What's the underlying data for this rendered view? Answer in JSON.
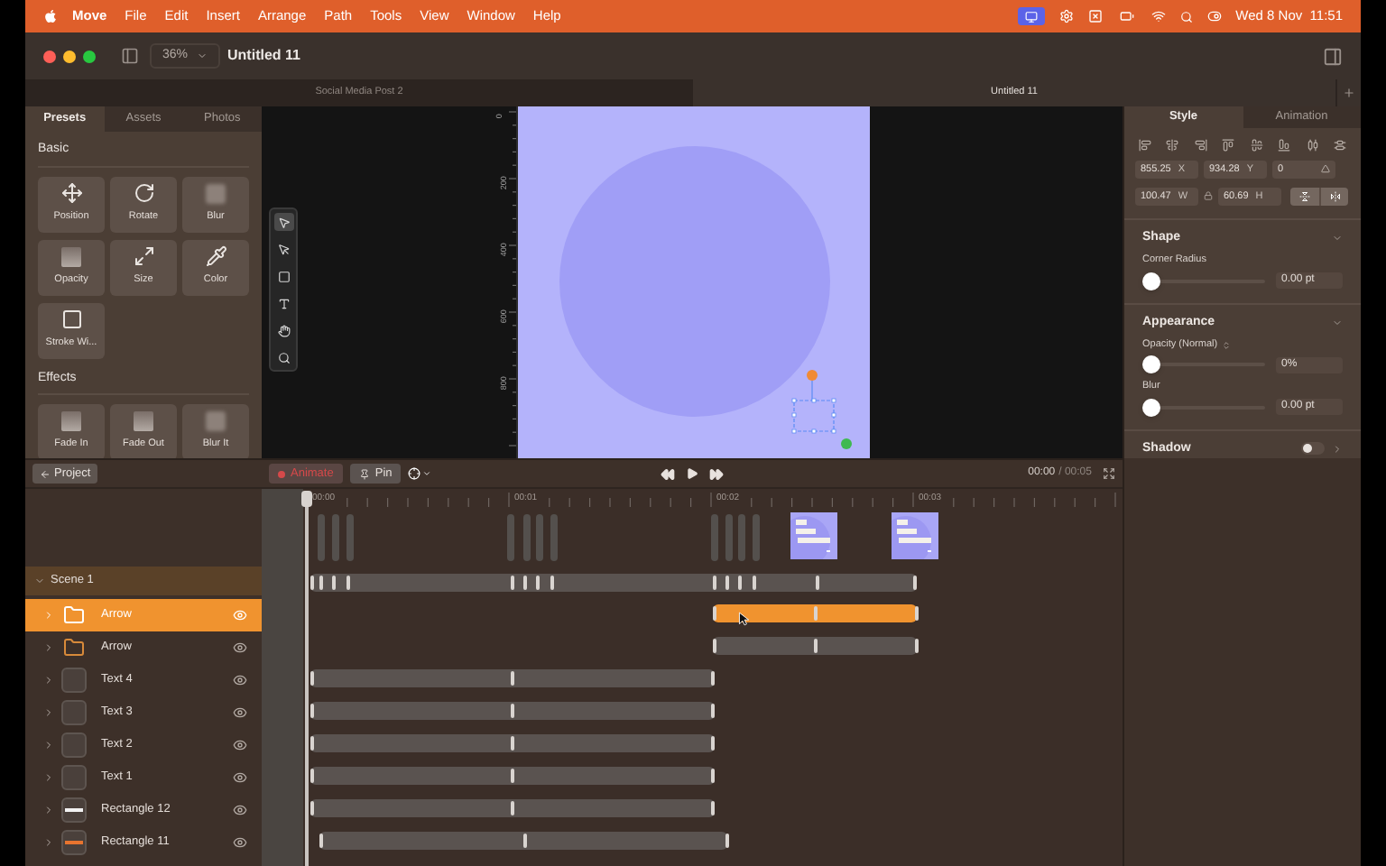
{
  "menu_bar": {
    "app": "Move",
    "items": [
      "File",
      "Edit",
      "Insert",
      "Arrange",
      "Path",
      "Tools",
      "View",
      "Window",
      "Help"
    ],
    "clock": "Wed 8 Nov  11:51"
  },
  "window": {
    "zoom": "36%",
    "title": "Untitled 11"
  },
  "document_tabs": [
    {
      "label": "Social Media Post 2",
      "selected": false
    },
    {
      "label": "Untitled 11",
      "selected": true
    }
  ],
  "library": {
    "tabs": [
      {
        "label": "Presets",
        "selected": true
      },
      {
        "label": "Assets",
        "selected": false
      },
      {
        "label": "Photos",
        "selected": false
      }
    ],
    "sections": [
      {
        "title": "Basic",
        "presets": [
          {
            "label": "Position",
            "kind": "move"
          },
          {
            "label": "Rotate",
            "kind": "rotate"
          },
          {
            "label": "Blur",
            "kind": "blur"
          },
          {
            "label": "Opacity",
            "kind": "fade"
          },
          {
            "label": "Size",
            "kind": "resize"
          },
          {
            "label": "Color",
            "kind": "picker"
          },
          {
            "label": "Stroke Wi...",
            "kind": "stroke"
          }
        ]
      },
      {
        "title": "Effects",
        "presets": [
          {
            "label": "Fade In",
            "kind": "fade"
          },
          {
            "label": "Fade Out",
            "kind": "fade"
          },
          {
            "label": "Blur It",
            "kind": "blur"
          }
        ]
      }
    ]
  },
  "canvas": {
    "ruler_labels": [
      "0",
      "200",
      "400",
      "600",
      "800"
    ],
    "tools": [
      {
        "kind": "select",
        "selected": true
      },
      {
        "kind": "direct",
        "selected": false
      },
      {
        "kind": "shape",
        "selected": false
      },
      {
        "kind": "text",
        "selected": false
      },
      {
        "kind": "hand",
        "selected": false
      },
      {
        "kind": "zoom",
        "selected": false
      }
    ]
  },
  "timeline": {
    "back_button": "Project",
    "animate_button": "Animate",
    "pin_button": "Pin",
    "current_time": "00:00",
    "duration": "/ 00:05",
    "ruler_labels": [
      "00:00",
      "00:01",
      "00:02",
      "00:03"
    ]
  },
  "layers": {
    "scene": {
      "name": "Scene 1",
      "expanded": true
    },
    "items": [
      {
        "name": "Arrow",
        "kind": "group",
        "selected": true,
        "expanded": false
      },
      {
        "name": "Arrow",
        "kind": "group",
        "selected": false,
        "expanded": false
      },
      {
        "name": "Text 4",
        "kind": "text",
        "selected": false,
        "expanded": false
      },
      {
        "name": "Text 3",
        "kind": "text",
        "selected": false,
        "expanded": false
      },
      {
        "name": "Text 2",
        "kind": "text",
        "selected": false,
        "expanded": false
      },
      {
        "name": "Text 1",
        "kind": "text",
        "selected": false,
        "expanded": false
      },
      {
        "name": "Rectangle 12",
        "kind": "shape",
        "color": "#f2f2f2",
        "selected": false,
        "expanded": false
      },
      {
        "name": "Rectangle 11",
        "kind": "shape",
        "color": "#e8742f",
        "selected": false,
        "expanded": false
      }
    ]
  },
  "inspector": {
    "tabs": [
      {
        "label": "Style",
        "selected": true
      },
      {
        "label": "Animation",
        "selected": false
      }
    ],
    "fields": [
      [
        {
          "value": "855.25",
          "label": "X",
          "kind": "axis"
        },
        {
          "value": "934.28",
          "label": "Y",
          "kind": "axis"
        },
        {
          "value": "0",
          "kind": "angle"
        }
      ],
      [
        {
          "value": "100.47",
          "label": "W",
          "kind": "axis"
        },
        {
          "value": "60.69",
          "label": "H",
          "kind": "axis"
        }
      ]
    ],
    "sections": [
      {
        "title": "Shape",
        "kind": "sliders",
        "expanded": true,
        "controls": [
          {
            "label": "Corner Radius",
            "kind": "plain",
            "level": 0,
            "value": "0.00 pt"
          }
        ]
      },
      {
        "title": "Appearance",
        "kind": "sliders",
        "expanded": true,
        "controls": [
          {
            "label": "Opacity (Normal)",
            "kind": "mode",
            "level": 0,
            "value": "0%"
          },
          {
            "label": "Blur",
            "kind": "plain",
            "level": 0,
            "value": "0.00 pt"
          }
        ]
      },
      {
        "title": "Shadow",
        "kind": "toggle",
        "expanded": false,
        "on": false
      }
    ]
  }
}
